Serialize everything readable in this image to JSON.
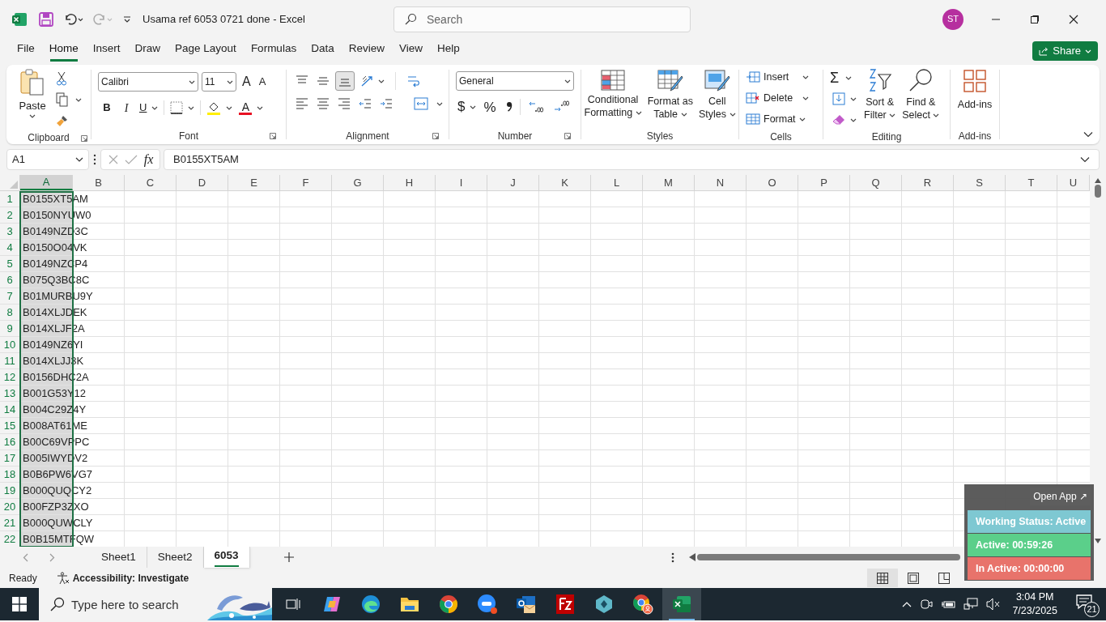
{
  "window": {
    "title": "Usama ref 6053 0721 done  -  Excel",
    "search_placeholder": "Search",
    "user_initials": "ST"
  },
  "menu_tabs": [
    {
      "label": "File",
      "selected": false
    },
    {
      "label": "Home",
      "selected": true
    },
    {
      "label": "Insert",
      "selected": false
    },
    {
      "label": "Draw",
      "selected": false
    },
    {
      "label": "Page Layout",
      "selected": false
    },
    {
      "label": "Formulas",
      "selected": false
    },
    {
      "label": "Data",
      "selected": false
    },
    {
      "label": "Review",
      "selected": false
    },
    {
      "label": "View",
      "selected": false
    },
    {
      "label": "Help",
      "selected": false
    }
  ],
  "share_button": "Share",
  "ribbon": {
    "clipboard": {
      "paste": "Paste",
      "label": "Clipboard"
    },
    "font": {
      "family": "Calibri",
      "size": "11",
      "grow": "A",
      "shrink": "A",
      "bold": "B",
      "italic": "I",
      "underline": "U",
      "font_color": "A",
      "label": "Font"
    },
    "alignment": {
      "label": "Alignment"
    },
    "number": {
      "format": "General",
      "currency": "$",
      "percent": "%",
      "label": "Number"
    },
    "styles": {
      "buttons": [
        {
          "lines": [
            "Conditional",
            "Formatting"
          ]
        },
        {
          "lines": [
            "Format as",
            "Table"
          ]
        },
        {
          "lines": [
            "Cell",
            "Styles"
          ]
        }
      ],
      "label": "Styles"
    },
    "cells": {
      "buttons": [
        "Insert",
        "Delete",
        "Format"
      ],
      "label": "Cells"
    },
    "editing": {
      "autosum": "Σ",
      "buttons": [
        {
          "lines": [
            "Sort &",
            "Filter"
          ]
        },
        {
          "lines": [
            "Find &",
            "Select"
          ]
        }
      ],
      "label": "Editing"
    },
    "addins": {
      "button": "Add-ins",
      "label": "Add-ins"
    }
  },
  "formula_bar": {
    "name_box": "A1",
    "function_label": "fx",
    "value": "B0155XT5AM"
  },
  "sheet": {
    "columns": [
      {
        "label": "A",
        "selected": true
      },
      {
        "label": "B",
        "selected": false
      },
      {
        "label": "C",
        "selected": false
      },
      {
        "label": "D",
        "selected": false
      },
      {
        "label": "E",
        "selected": false
      },
      {
        "label": "F",
        "selected": false
      },
      {
        "label": "G",
        "selected": false
      },
      {
        "label": "H",
        "selected": false
      },
      {
        "label": "I",
        "selected": false
      },
      {
        "label": "J",
        "selected": false
      },
      {
        "label": "K",
        "selected": false
      },
      {
        "label": "L",
        "selected": false
      },
      {
        "label": "M",
        "selected": false
      },
      {
        "label": "N",
        "selected": false
      },
      {
        "label": "O",
        "selected": false
      },
      {
        "label": "P",
        "selected": false
      },
      {
        "label": "Q",
        "selected": false
      },
      {
        "label": "R",
        "selected": false
      },
      {
        "label": "S",
        "selected": false
      },
      {
        "label": "T",
        "selected": false
      },
      {
        "label": "U",
        "selected": false
      }
    ],
    "rows": [
      {
        "number": "1",
        "a": "B0155XT5AM"
      },
      {
        "number": "2",
        "a": "B0150NYUW0"
      },
      {
        "number": "3",
        "a": "B0149NZD3C"
      },
      {
        "number": "4",
        "a": "B0150O04VK"
      },
      {
        "number": "5",
        "a": "B0149NZCP4"
      },
      {
        "number": "6",
        "a": "B075Q3BC8C"
      },
      {
        "number": "7",
        "a": "B01MURBU9Y"
      },
      {
        "number": "8",
        "a": "B014XLJDEK"
      },
      {
        "number": "9",
        "a": "B014XLJF2A"
      },
      {
        "number": "10",
        "a": "B0149NZ6YI"
      },
      {
        "number": "11",
        "a": "B014XLJJ3K"
      },
      {
        "number": "12",
        "a": "B0156DHC2A"
      },
      {
        "number": "13",
        "a": "B001G53Y12"
      },
      {
        "number": "14",
        "a": "B004C29Z4Y"
      },
      {
        "number": "15",
        "a": "B008AT61ME"
      },
      {
        "number": "16",
        "a": "B00C69VPPC"
      },
      {
        "number": "17",
        "a": "B005IWYDV2"
      },
      {
        "number": "18",
        "a": "B0B6PW6VG7"
      },
      {
        "number": "19",
        "a": "B000QUQCY2"
      },
      {
        "number": "20",
        "a": "B00FZP3ZXO"
      },
      {
        "number": "21",
        "a": "B000QUWCLY"
      },
      {
        "number": "22",
        "a": "B0B15MTFQW"
      }
    ]
  },
  "sheet_tabs": [
    {
      "label": "Sheet1",
      "selected": false
    },
    {
      "label": "Sheet2",
      "selected": false
    },
    {
      "label": "6053",
      "selected": true
    }
  ],
  "status_bar": {
    "mode": "Ready",
    "accessibility": "Accessibility: Investigate"
  },
  "tracker": {
    "open_app": "Open App ↗",
    "statuses": [
      {
        "text": "Working Status: Active",
        "color": "#7ec8d2"
      },
      {
        "text": "Active: 00:59:26",
        "color": "#5bcf8a"
      },
      {
        "text": "In Active: 00:00:00",
        "color": "#e8736b"
      }
    ]
  },
  "taskbar": {
    "search_placeholder": "Type here to search",
    "time": "3:04 PM",
    "date": "7/23/2025",
    "notifications": "21"
  }
}
